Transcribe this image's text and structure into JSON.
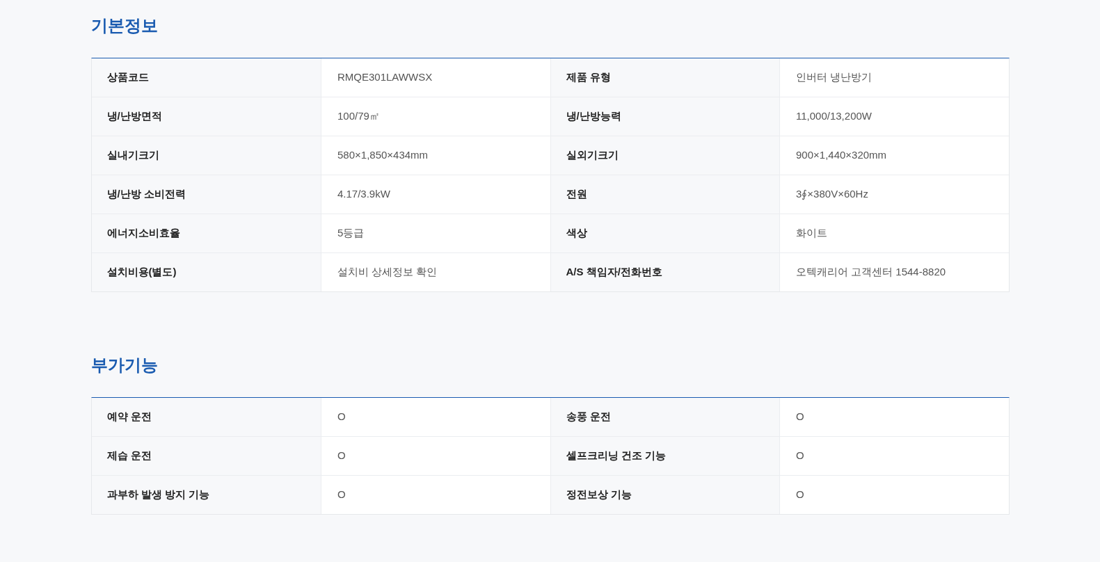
{
  "sections": [
    {
      "title": "기본정보",
      "rows": [
        [
          {
            "label": "상품코드",
            "value": "RMQE301LAWWSX"
          },
          {
            "label": "제품 유형",
            "value": "인버터 냉난방기"
          }
        ],
        [
          {
            "label": "냉/난방면적",
            "value": "100/79㎡"
          },
          {
            "label": "냉/난방능력",
            "value": "11,000/13,200W"
          }
        ],
        [
          {
            "label": "실내기크기",
            "value": "580×1,850×434mm"
          },
          {
            "label": "실외기크기",
            "value": "900×1,440×320mm"
          }
        ],
        [
          {
            "label": "냉/난방 소비전력",
            "value": "4.17/3.9kW"
          },
          {
            "label": "전원",
            "value": "3∮×380V×60Hz"
          }
        ],
        [
          {
            "label": "에너지소비효율",
            "value": "5등급"
          },
          {
            "label": "색상",
            "value": "화이트"
          }
        ],
        [
          {
            "label": "설치비용(별도)",
            "value": "설치비 상세정보 확인"
          },
          {
            "label": "A/S 책임자/전화번호",
            "value": "오텍캐리어 고객센터 1544-8820"
          }
        ]
      ]
    },
    {
      "title": "부가기능",
      "rows": [
        [
          {
            "label": "예약 운전",
            "value": "O"
          },
          {
            "label": "송풍 운전",
            "value": "O"
          }
        ],
        [
          {
            "label": "제습 운전",
            "value": "O"
          },
          {
            "label": "셀프크리닝 건조 기능",
            "value": "O"
          }
        ],
        [
          {
            "label": "과부하 발생 방지 기능",
            "value": "O"
          },
          {
            "label": "정전보상 기능",
            "value": "O"
          }
        ]
      ]
    }
  ]
}
